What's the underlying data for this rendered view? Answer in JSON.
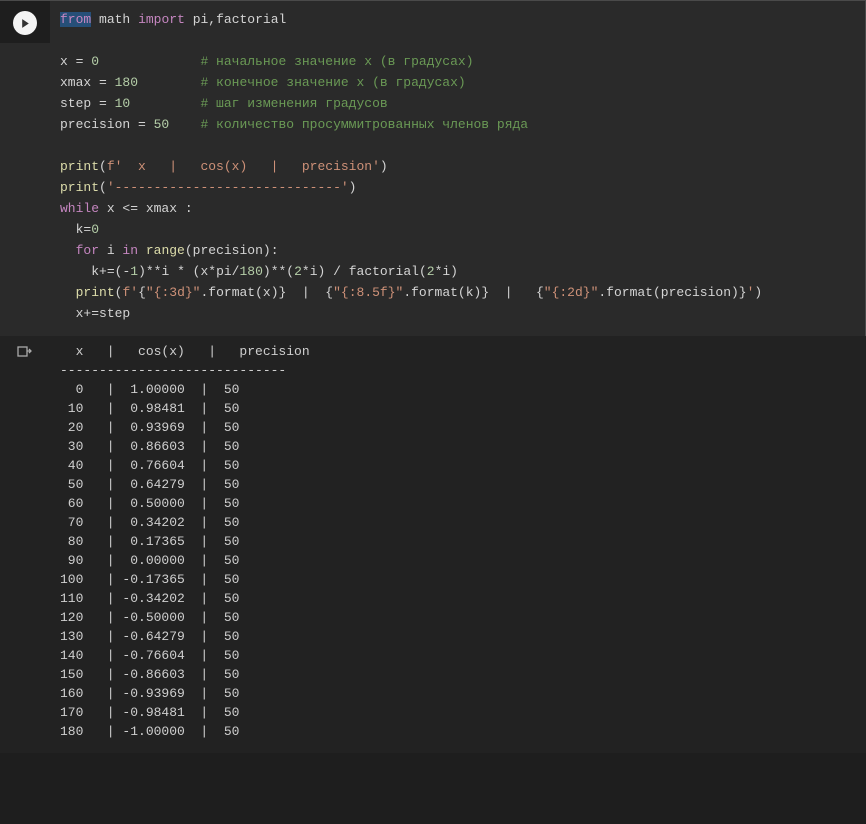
{
  "code": {
    "l1": {
      "from": "from",
      "mod": "math",
      "import": "import",
      "names": "pi,factorial"
    },
    "l2": {
      "var": "x",
      "eq": " = ",
      "val": "0",
      "cmt": "# начальное значение x (в градусах)"
    },
    "l3": {
      "var": "xmax",
      "eq": " = ",
      "val": "180",
      "cmt": "# конечное значение x (в градусах)"
    },
    "l4": {
      "var": "step",
      "eq": " = ",
      "val": "10",
      "cmt": "# шаг изменения градусов"
    },
    "l5": {
      "var": "precision",
      "eq": " = ",
      "val": "50",
      "cmt": "# количество просуммитрованных членов ряда"
    },
    "l6": {
      "fn": "print",
      "open": "(",
      "pre": "f",
      "str": "'  x   |   cos(x)   |   precision'",
      "close": ")"
    },
    "l7": {
      "fn": "print",
      "open": "(",
      "str": "'-----------------------------'",
      "close": ")"
    },
    "l8": {
      "while": "while",
      "cond1": " x ",
      "op": "<=",
      "cond2": " xmax ",
      "colon": ":"
    },
    "l9": {
      "indent": "  ",
      "var": "k",
      "eq": "=",
      "val": "0"
    },
    "l10": {
      "indent": "  ",
      "for": "for",
      "i": " i ",
      "in": "in",
      "sp": " ",
      "range": "range",
      "open": "(",
      "arg": "precision",
      "close": "):"
    },
    "l11": {
      "indent": "    ",
      "lhs": "k",
      "opn": "+=",
      "rest1": "(-",
      "n1": "1",
      "rest2": ")**i * (x*pi/",
      "n2": "180",
      "rest3": ")**(",
      "n3": "2",
      "rest4": "*i) / factorial(",
      "n4": "2",
      "rest5": "*i)"
    },
    "l12": {
      "indent": "  ",
      "print": "print",
      "open": "(",
      "f": "f",
      "q": "'",
      "p1": "{",
      "s1": "\"{:3d}\"",
      "p2": ".format(x)}  |  {",
      "s2": "\"{:8.5f}\"",
      "p3": ".format(k)}  |   {",
      "s3": "\"{:2d}\"",
      "p4": ".format(precision)}",
      "qe": "'",
      "close": ")"
    },
    "l13": {
      "indent": "  ",
      "var": "x",
      "opn": "+=",
      "rhs": "step"
    }
  },
  "output": {
    "header": "  x   |   cos(x)   |   precision",
    "sep": "-----------------------------",
    "rows": [
      "  0   |  1.00000  |  50",
      " 10   |  0.98481  |  50",
      " 20   |  0.93969  |  50",
      " 30   |  0.86603  |  50",
      " 40   |  0.76604  |  50",
      " 50   |  0.64279  |  50",
      " 60   |  0.50000  |  50",
      " 70   |  0.34202  |  50",
      " 80   |  0.17365  |  50",
      " 90   |  0.00000  |  50",
      "100   | -0.17365  |  50",
      "110   | -0.34202  |  50",
      "120   | -0.50000  |  50",
      "130   | -0.64279  |  50",
      "140   | -0.76604  |  50",
      "150   | -0.86603  |  50",
      "160   | -0.93969  |  50",
      "170   | -0.98481  |  50",
      "180   | -1.00000  |  50"
    ]
  }
}
